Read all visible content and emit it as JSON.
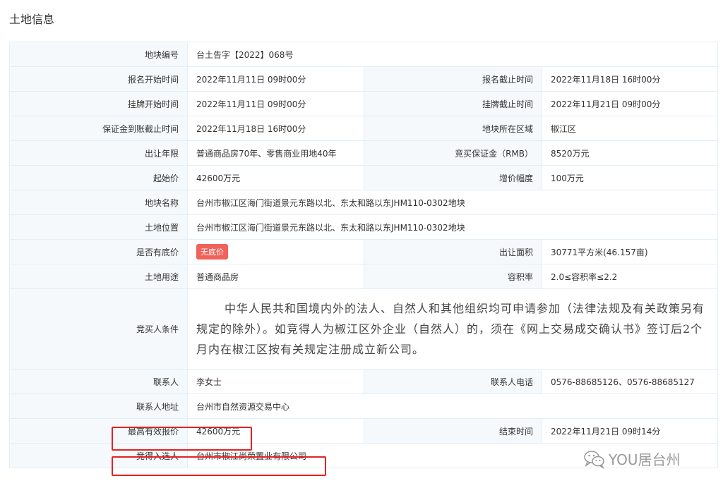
{
  "page": {
    "title": "土地信息"
  },
  "rows": {
    "plot_no": {
      "label": "地块编号",
      "value": "台土告字【2022】068号"
    },
    "reg_start": {
      "label": "报名开始时间",
      "value": "2022年11月11日 09时00分"
    },
    "reg_end": {
      "label": "报名截止时间",
      "value": "2022年11月18日 16时00分"
    },
    "list_start": {
      "label": "挂牌开始时间",
      "value": "2022年11月11日 09时00分"
    },
    "list_end": {
      "label": "挂牌截止时间",
      "value": "2022年11月21日 09时00分"
    },
    "deposit_deadline": {
      "label": "保证金到账截止时间",
      "value": "2022年11月18日 16时00分"
    },
    "district": {
      "label": "地块所在区域",
      "value": "椒江区"
    },
    "term": {
      "label": "出让年限",
      "value": "普通商品房70年、零售商业用地40年"
    },
    "deposit": {
      "label": "竞买保证金（RMB）",
      "value": "8520万元"
    },
    "start_price": {
      "label": "起始价",
      "value": "42600万元"
    },
    "increment": {
      "label": "增价幅度",
      "value": "100万元"
    },
    "plot_name": {
      "label": "地块名称",
      "value": "台州市椒江区海门街道景元东路以北、东太和路以东JHM110-0302地块"
    },
    "location": {
      "label": "土地位置",
      "value": "台州市椒江区海门街道景元东路以北、东太和路以东JHM110-0302地块"
    },
    "reserve": {
      "label": "是否有底价",
      "value": "无底价"
    },
    "area": {
      "label": "出让面积",
      "value": "30771平方米(46.157亩)"
    },
    "usage": {
      "label": "土地用途",
      "value": "普通商品房"
    },
    "far": {
      "label": "容积率",
      "value": "2.0≤容积率≤2.2"
    },
    "conditions": {
      "label": "竞买人条件",
      "value": "中华人民共和国境内外的法人、自然人和其他组织均可申请参加（法律法规及有关政策另有规定的除外）。如竞得人为椒江区外企业（自然人）的，须在《网上交易成交确认书》签订后2个月内在椒江区按有关规定注册成立新公司。"
    },
    "contact": {
      "label": "联系人",
      "value": "李女士"
    },
    "phone": {
      "label": "联系人电话",
      "value": "0576-88685126、0576-88685127"
    },
    "address": {
      "label": "联系人地址",
      "value": "台州市自然资源交易中心"
    },
    "top_bid": {
      "label": "最高有效报价",
      "value": "42600万元"
    },
    "end_time": {
      "label": "结束时间",
      "value": "2022年11月21日 09时14分"
    },
    "winner": {
      "label": "竞得入选人",
      "value": "台州市椒江尚荣置业有限公司"
    }
  },
  "watermark": {
    "text": "YOU居台州",
    "icon": "wechat-icon"
  },
  "colors": {
    "highlight": "#e22222",
    "badge": "#f0625a",
    "label_bg": "#f5f9fc",
    "border": "#e3eef7"
  }
}
